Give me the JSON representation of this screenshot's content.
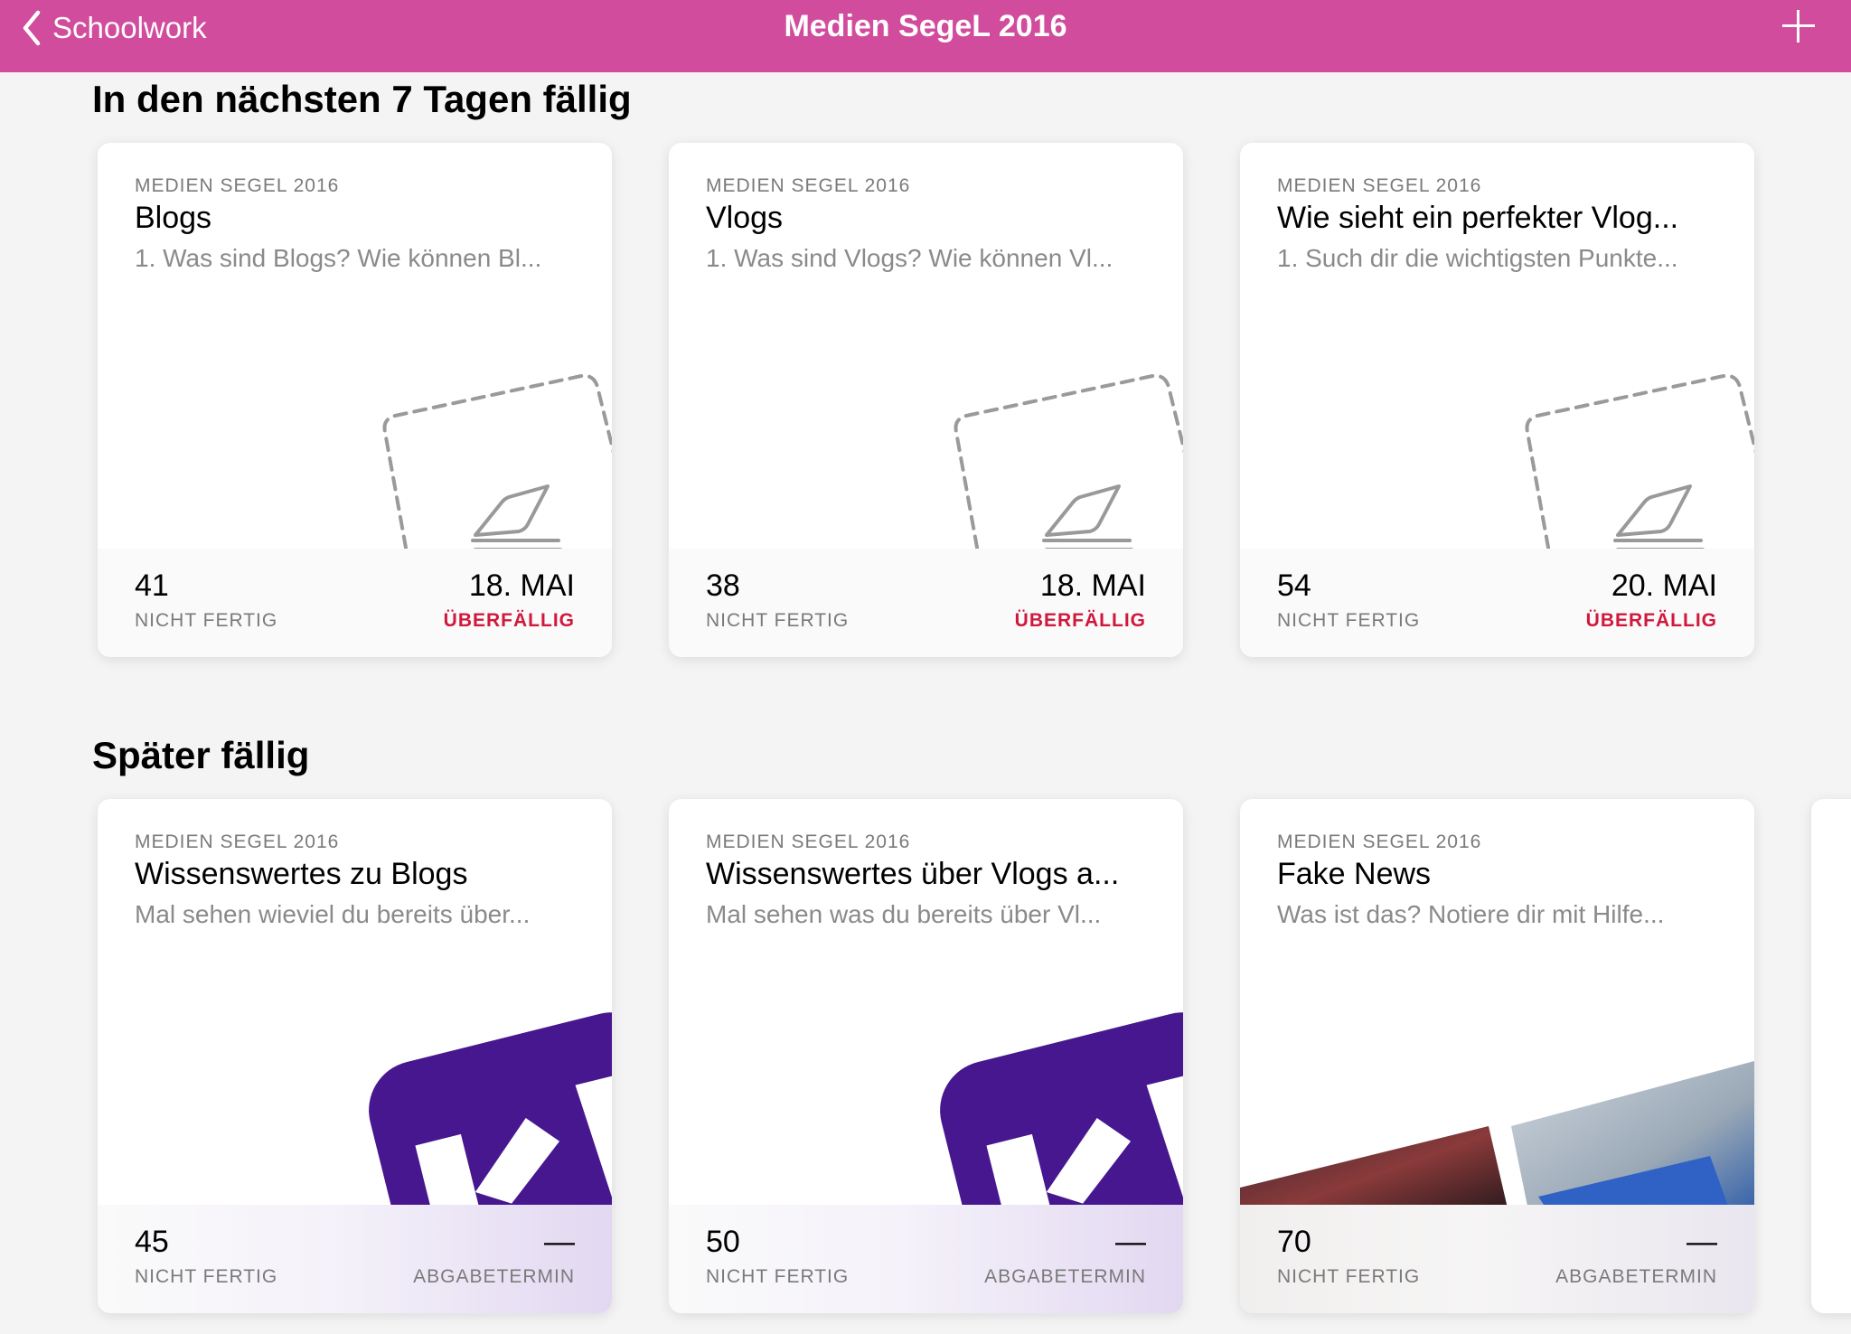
{
  "navbar": {
    "back_label": "Schoolwork",
    "title": "Medien SegeL 2016",
    "accent": "#d14c9d"
  },
  "sections": [
    {
      "title": "In den nächsten 7 Tagen fällig",
      "cards": [
        {
          "class_name": "MEDIEN SEGEL 2016",
          "title": "Blogs",
          "description": "1. Was sind Blogs? Wie können Bl...",
          "count": "41",
          "count_label": "NICHT FERTIG",
          "date": "18. MAI",
          "status": "ÜBERFÄLLIG",
          "art": "dashed-pen-icon"
        },
        {
          "class_name": "MEDIEN SEGEL 2016",
          "title": "Vlogs",
          "description": "1. Was sind Vlogs? Wie können Vl...",
          "count": "38",
          "count_label": "NICHT FERTIG",
          "date": "18. MAI",
          "status": "ÜBERFÄLLIG",
          "art": "dashed-pen-icon"
        },
        {
          "class_name": "MEDIEN SEGEL 2016",
          "title": "Wie sieht ein perfekter Vlog...",
          "description": "1. Such dir die wichtigsten Punkte...",
          "count": "54",
          "count_label": "NICHT FERTIG",
          "date": "20. MAI",
          "status": "ÜBERFÄLLIG",
          "art": "dashed-pen-icon"
        }
      ]
    },
    {
      "title": "Später fällig",
      "cards": [
        {
          "class_name": "MEDIEN SEGEL 2016",
          "title": "Wissenswertes zu Blogs",
          "description": "Mal sehen wieviel du bereits über...",
          "count": "45",
          "count_label": "NICHT FERTIG",
          "date": "—",
          "status": "ABGABETERMIN",
          "art": "kahoot-icon"
        },
        {
          "class_name": "MEDIEN SEGEL 2016",
          "title": "Wissenswertes über Vlogs a...",
          "description": "Mal sehen was du bereits über Vl...",
          "count": "50",
          "count_label": "NICHT FERTIG",
          "date": "—",
          "status": "ABGABETERMIN",
          "art": "kahoot-icon"
        },
        {
          "class_name": "MEDIEN SEGEL 2016",
          "title": "Fake News",
          "description": "Was ist das? Notiere dir mit Hilfe...",
          "count": "70",
          "count_label": "NICHT FERTIG",
          "date": "—",
          "status": "ABGABETERMIN",
          "art": "fake-news-photo"
        }
      ]
    }
  ],
  "colors": {
    "overdue": "#d0183c",
    "kahoot_purple": "#46178f",
    "background": "#f4f4f4"
  }
}
